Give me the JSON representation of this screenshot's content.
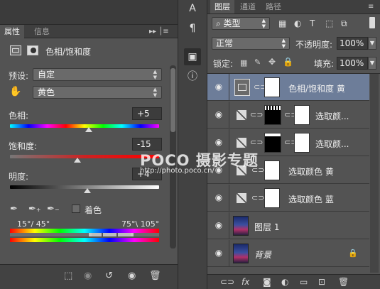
{
  "properties_panel": {
    "tabs": [
      {
        "label": "属性"
      },
      {
        "label": "信息"
      }
    ],
    "menu_glyph": "▸▸ │≡",
    "title": "色相/饱和度",
    "preset": {
      "label": "预设:",
      "value": "自定"
    },
    "channel": {
      "value": "黄色"
    },
    "hue": {
      "label": "色相:",
      "value": "+5",
      "fraction": 0.53
    },
    "saturation": {
      "label": "饱和度:",
      "value": "-15",
      "fraction": 0.45
    },
    "lightness": {
      "label": "明度:",
      "value": "+4",
      "fraction": 0.52
    },
    "colorize": {
      "label": "着色"
    },
    "range": {
      "left": "15°/ 45°",
      "right": "75°\\ 105°"
    }
  },
  "layers_panel": {
    "tabs": [
      {
        "label": "图层"
      },
      {
        "label": "通道"
      },
      {
        "label": "路径"
      }
    ],
    "filter_kind": "类型",
    "blend_mode": "正常",
    "opacity_label": "不透明度:",
    "opacity_value": "100%",
    "lock_label": "锁定:",
    "fill_label": "填充:",
    "fill_value": "100%",
    "layers": [
      {
        "name": "色相/饱和度 黄",
        "selected": true
      },
      {
        "name": "选取颜..."
      },
      {
        "name": "选取颜..."
      },
      {
        "name": "选取颜色 黄"
      },
      {
        "name": "选取颜色 蓝"
      },
      {
        "name": "图层 1"
      },
      {
        "name": "背景"
      }
    ]
  },
  "watermark": {
    "title": "POCO 摄影专题",
    "url": "http://photo.poco.cn/"
  },
  "colors": {
    "selected_layer": "#6d7d99",
    "panel_bg": "#535353",
    "dark_bg": "#3f3f3f"
  }
}
